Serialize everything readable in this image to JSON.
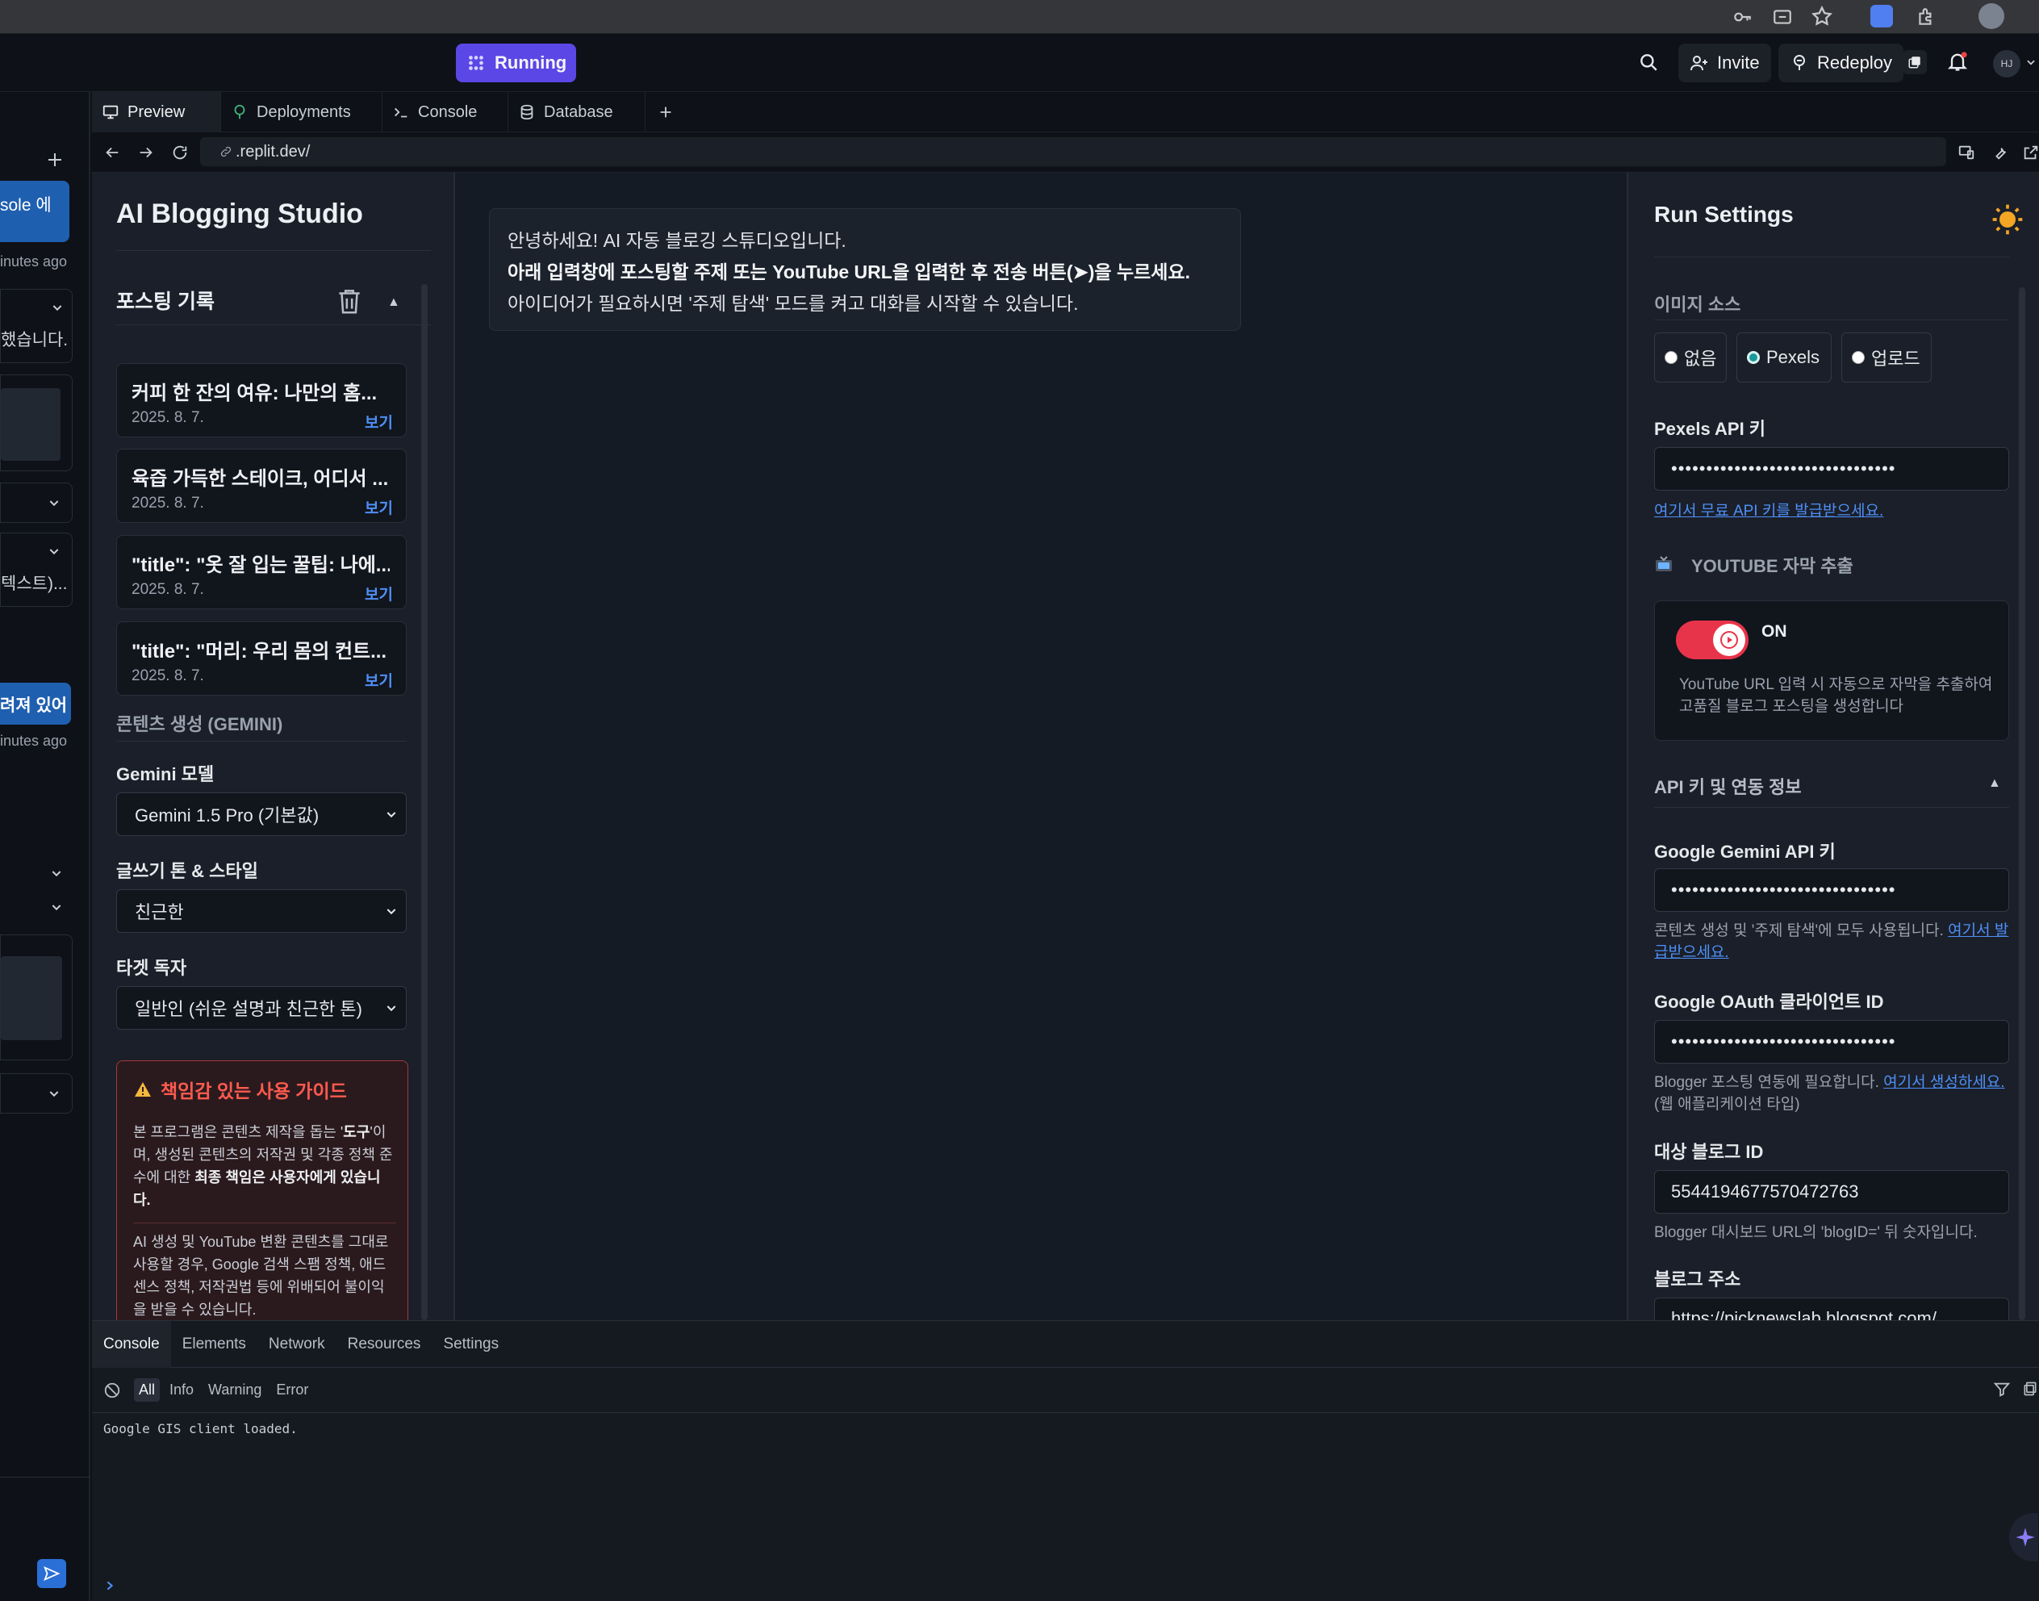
{
  "topbar": {
    "status_label": "Running",
    "invite_label": "Invite",
    "redeploy_label": "Redeploy",
    "avatar_initials": "HJ"
  },
  "left_panel": {
    "snippet_1": "sole 에",
    "time_1": "inutes ago",
    "snippet_2": "했습니다.",
    "snippet_3": "텍스트)...",
    "snippet_4": "려져 있어",
    "time_2": "inutes ago"
  },
  "tabs": [
    {
      "label": "Preview"
    },
    {
      "label": "Deployments"
    },
    {
      "label": "Console"
    },
    {
      "label": "Database"
    }
  ],
  "url": ".replit.dev/",
  "sidebar": {
    "app_title": "AI Blogging Studio",
    "history_title": "포스팅 기록",
    "history": [
      {
        "title": "커피 한 잔의 여유: 나만의 홈...",
        "date": "2025. 8. 7.",
        "link": "보기"
      },
      {
        "title": "육즙 가득한 스테이크, 어디서 ...",
        "date": "2025. 8. 7.",
        "link": "보기"
      },
      {
        "title": "\"title\": \"옷 잘 입는 꿀팁: 나에...",
        "date": "2025. 8. 7.",
        "link": "보기"
      },
      {
        "title": "\"title\": \"머리: 우리 몸의 컨트...",
        "date": "2025. 8. 7.",
        "link": "보기"
      }
    ],
    "gen_section": "콘텐츠 생성 (GEMINI)",
    "model_label": "Gemini 모델",
    "model_value": "Gemini 1.5 Pro (기본값)",
    "tone_label": "글쓰기 톤 & 스타일",
    "tone_value": "친근한",
    "target_label": "타겟 독자",
    "target_value": "일반인 (쉬운 설명과 친근한 톤)",
    "guide_title": "책임감 있는 사용 가이드",
    "guide_p1_a": "본 프로그램은 콘텐츠 제작을 돕는 '",
    "guide_p1_b": "도구",
    "guide_p1_c": "'이며, 생성된 콘텐츠의 저작권 및 각종 정책 준수에 대한 ",
    "guide_p1_d": "최종 책임은 사용자에게 있습니다.",
    "guide_p2": "AI 생성 및 YouTube 변환 콘텐츠를 그대로 사용할 경우, Google 검색 스팸 정책, 애드센스 정책, 저작권법 등에 위배되어 불이익을 받을 수 있습니다."
  },
  "chat": {
    "line1": "안녕하세요! AI 자동 블로깅 스튜디오입니다.",
    "line2": "아래 입력창에 포스팅할 주제 또는 YouTube URL을 입력한 후 전송 버튼(➤)을 누르세요.",
    "line3": "아이디어가 필요하시면 '주제 탐색' 모드를 켜고 대화를 시작할 수 있습니다."
  },
  "run_settings": {
    "title": "Run Settings",
    "image_source_label": "이미지 소스",
    "image_options": [
      "없음",
      "Pexels",
      "업로드"
    ],
    "image_selected": "Pexels",
    "pexels_label": "Pexels API 키",
    "pexels_value": "••••••••••••••••••••••••••••••••",
    "pexels_link": "여기서 무료 API 키를 발급받으세요.",
    "youtube_label": "YOUTUBE 자막 추출",
    "toggle_state": "ON",
    "youtube_desc": "YouTube URL 입력 시 자동으로 자막을 추출하여 고품질 블로그 포스팅을 생성합니다",
    "api_section": "API 키 및 연동 정보",
    "gemini_key_label": "Google Gemini API 키",
    "gemini_key_value": "••••••••••••••••••••••••••••••••",
    "gemini_help": "콘텐츠 생성 및 '주제 탐색'에 모두 사용됩니다. ",
    "gemini_help_link": "여기서 발급받으세요.",
    "oauth_label": "Google OAuth 클라이언트 ID",
    "oauth_value": "••••••••••••••••••••••••••••••••",
    "oauth_help": "Blogger 포스팅 연동에 필요합니다. ",
    "oauth_help_link": "여기서 생성하세요.",
    "oauth_help_tail": " (웹 애플리케이션 타입)",
    "blog_id_label": "대상 블로그 ID",
    "blog_id_value": "5544194677570472763",
    "blog_id_help": "Blogger 대시보드 URL의 'blogID=' 뒤 숫자입니다.",
    "blog_url_label": "블로그 주소",
    "blog_url_value": "https://picknewslab.blogspot.com/"
  },
  "devtools": {
    "tabs": [
      "Console",
      "Elements",
      "Network",
      "Resources",
      "Settings"
    ],
    "filters": [
      "All",
      "Info",
      "Warning",
      "Error"
    ],
    "log": "Google GIS client loaded."
  },
  "colors": {
    "accent": "#5b47e6",
    "link": "#4f8ff7",
    "toggle_on": "#e8344a",
    "warning": "#ff5a4f"
  }
}
